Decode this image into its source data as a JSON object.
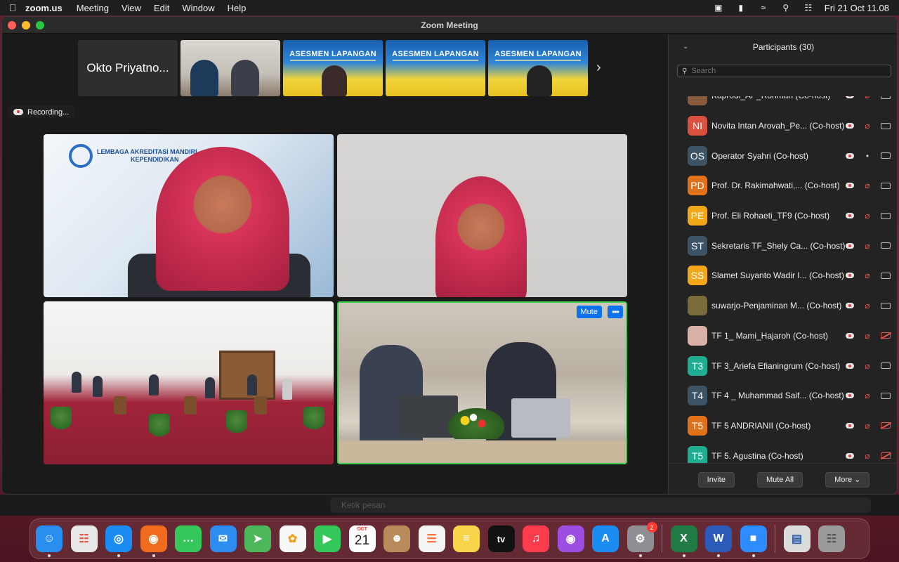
{
  "menubar": {
    "app_name": "zoom.us",
    "menus": [
      "Meeting",
      "View",
      "Edit",
      "Window",
      "Help"
    ],
    "clock": "Fri 21 Oct  11.08"
  },
  "window": {
    "title": "Zoom Meeting"
  },
  "thumbstrip": {
    "name_tile": "Okto Priyatno...",
    "banner_title": "ASESMEN LAPANGAN"
  },
  "recording_label": "Recording...",
  "tiles": {
    "org_name": "LEMBAGA AKREDITASI MANDIRI",
    "org_sub": "KEPENDIDIKAN",
    "mute_label": "Mute",
    "more_label": "•••"
  },
  "participants": {
    "title": "Participants (30)",
    "search_placeholder": "Search",
    "items": [
      {
        "initials": "",
        "name": "Kaprodi_AP_Rohman (Co-host)",
        "color": "#8a5a3c",
        "mic": "muted",
        "cam": "on"
      },
      {
        "initials": "NI",
        "name": "Novita Intan Arovah_Pe...  (Co-host)",
        "color": "#d9503e",
        "mic": "muted",
        "cam": "on"
      },
      {
        "initials": "OS",
        "name": "Operator Syahri (Co-host)",
        "color": "#3d5366",
        "mic": "on",
        "cam": "on"
      },
      {
        "initials": "PD",
        "name": "Prof. Dr. Rakimahwati,...  (Co-host)",
        "color": "#e0721c",
        "mic": "muted",
        "cam": "on"
      },
      {
        "initials": "PE",
        "name": "Prof. Eli Rohaeti_TF9 (Co-host)",
        "color": "#f0a81a",
        "mic": "muted",
        "cam": "on"
      },
      {
        "initials": "ST",
        "name": "Sekretaris TF_Shely Ca...  (Co-host)",
        "color": "#3d5366",
        "mic": "muted",
        "cam": "on"
      },
      {
        "initials": "SS",
        "name": "Slamet Suyanto Wadir I...  (Co-host)",
        "color": "#f0a81a",
        "mic": "muted",
        "cam": "on"
      },
      {
        "initials": "",
        "name": "suwarjo-Penjaminan M...  (Co-host)",
        "color": "#7a6b3a",
        "mic": "muted",
        "cam": "on"
      },
      {
        "initials": "",
        "name": "TF 1_ Mami_Hajaroh (Co-host)",
        "color": "#d8b0a6",
        "mic": "muted",
        "cam": "off"
      },
      {
        "initials": "T3",
        "name": "TF 3_Ariefa Efianingrum (Co-host)",
        "color": "#1fae92",
        "mic": "muted",
        "cam": "on"
      },
      {
        "initials": "T4",
        "name": "TF 4 _ Muhammad Saif...  (Co-host)",
        "color": "#3d5366",
        "mic": "muted",
        "cam": "on"
      },
      {
        "initials": "T5",
        "name": "TF 5 ANDRIANII (Co-host)",
        "color": "#e0721c",
        "mic": "muted",
        "cam": "off"
      },
      {
        "initials": "T5",
        "name": "TF 5. Agustina (Co-host)",
        "color": "#1fae92",
        "mic": "muted",
        "cam": "off"
      }
    ],
    "footer": {
      "invite": "Invite",
      "mute_all": "Mute All",
      "more": "More"
    }
  },
  "chat_placeholder": "Ketik pesan",
  "dock": {
    "calendar_month": "OCT",
    "calendar_day": "21",
    "appletv_label": "tv",
    "settings_badge": "2",
    "apps": [
      {
        "name": "finder",
        "color": "#2a8df0",
        "glyph": "☺"
      },
      {
        "name": "launchpad",
        "color": "#e8e8e8",
        "glyph": "☷"
      },
      {
        "name": "safari",
        "color": "#1b8df2",
        "glyph": "◎"
      },
      {
        "name": "firefox",
        "color": "#f06b1d",
        "glyph": "◉"
      },
      {
        "name": "messages",
        "color": "#34c759",
        "glyph": "…"
      },
      {
        "name": "mail",
        "color": "#2d8cf0",
        "glyph": "✉"
      },
      {
        "name": "maps",
        "color": "#4db85a",
        "glyph": "➤"
      },
      {
        "name": "photos",
        "color": "#f7f7f7",
        "glyph": "✿"
      },
      {
        "name": "facetime",
        "color": "#34c759",
        "glyph": "▶"
      }
    ]
  }
}
